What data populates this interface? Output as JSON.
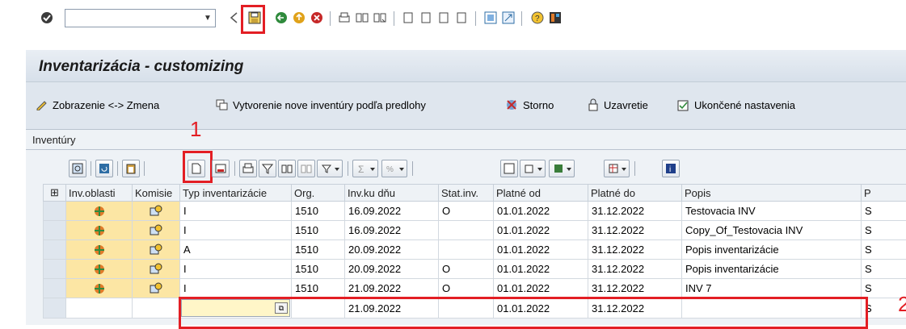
{
  "toolbar": {
    "icons": [
      "check-icon",
      "back-arrow-icon",
      "save-icon",
      "back-icon",
      "exit-icon",
      "cancel-icon",
      "print-icon",
      "find-icon",
      "find-next-icon",
      "first-page-icon",
      "prev-page-icon",
      "next-page-icon",
      "last-page-icon",
      "create-session-icon",
      "shortcut-icon",
      "help-icon",
      "layout-icon"
    ],
    "command_value": ""
  },
  "title": "Inventarizácia - customizing",
  "app_toolbar": {
    "toggle": "Zobrazenie <-> Zmena",
    "create_from_template": "Vytvorenie nove inventúry podľa predlohy",
    "cancel": "Storno",
    "close": "Uzavretie",
    "finished": "Ukončené nastavenia"
  },
  "group_title": "Inventúry",
  "annotations": {
    "one": "1",
    "two": "2"
  },
  "grid": {
    "headers": [
      "Inv.oblasti",
      "Komisie",
      "Typ inventarizácie",
      "Org.",
      "Inv.ku dňu",
      "Stat.inv.",
      "Platné od",
      "Platné do",
      "Popis",
      "P"
    ],
    "rows": [
      {
        "typ": "I",
        "org": "1510",
        "date": "16.09.2022",
        "stat": "O",
        "from": "01.01.2022",
        "to": "31.12.2022",
        "popis": "Testovacia INV",
        "p": "S"
      },
      {
        "typ": "I",
        "org": "1510",
        "date": "16.09.2022",
        "stat": "",
        "from": "01.01.2022",
        "to": "31.12.2022",
        "popis": "Copy_Of_Testovacia INV",
        "p": "S"
      },
      {
        "typ": "A",
        "org": "1510",
        "date": "20.09.2022",
        "stat": "",
        "from": "01.01.2022",
        "to": "31.12.2022",
        "popis": "Popis inventarizácie",
        "p": "S"
      },
      {
        "typ": "I",
        "org": "1510",
        "date": "20.09.2022",
        "stat": "O",
        "from": "01.01.2022",
        "to": "31.12.2022",
        "popis": "Popis inventarizácie",
        "p": "S"
      },
      {
        "typ": "I",
        "org": "1510",
        "date": "21.09.2022",
        "stat": "O",
        "from": "01.01.2022",
        "to": "31.12.2022",
        "popis": "INV 7",
        "p": "S"
      },
      {
        "typ": "",
        "org": "",
        "date": "21.09.2022",
        "stat": "",
        "from": "01.01.2022",
        "to": "31.12.2022",
        "popis": "",
        "p": "S"
      }
    ]
  },
  "colors": {
    "highlight": "#e31e24",
    "button_cell": "#fce6a4"
  }
}
